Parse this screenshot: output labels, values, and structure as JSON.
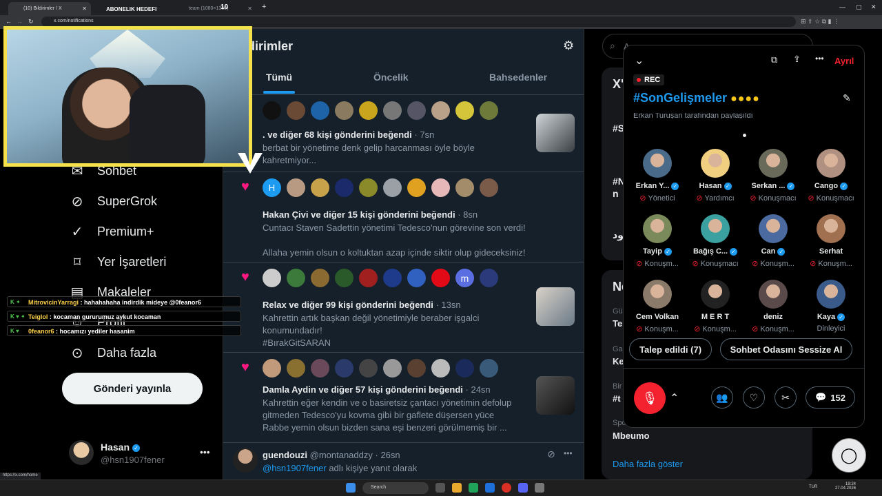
{
  "browser": {
    "tabs": [
      {
        "label": "(10) Bildirimler / X"
      },
      {
        "label": "ABONELIK HEDEFI"
      },
      {
        "label": "team (1080×1300)"
      },
      {
        "label": "10"
      }
    ],
    "url": "x.com/notifications",
    "status_url": "https://x.com/home"
  },
  "nav": {
    "items": [
      {
        "label": "Sohbet",
        "icon": "chat-icon"
      },
      {
        "label": "SuperGrok",
        "icon": "grok-icon"
      },
      {
        "label": "Premium+",
        "icon": "premium-icon"
      },
      {
        "label": "Yer İşaretleri",
        "icon": "bookmark-icon"
      },
      {
        "label": "Makaleler",
        "icon": "article-icon"
      },
      {
        "label": "Profil",
        "icon": "profile-icon"
      },
      {
        "label": "Daha fazla",
        "icon": "more-icon"
      }
    ],
    "post_button": "Gönderi yayınla",
    "account": {
      "name": "Hasan",
      "handle": "@hsn1907fener"
    }
  },
  "feed": {
    "title": "dirimler",
    "tabs": [
      "Tümü",
      "Öncelik",
      "Bahsedenler"
    ],
    "notifications": [
      {
        "actor": ".",
        "rest": " ve diğer 68 kişi gönderini beğendi",
        "time": "· 7sn",
        "lines": [
          "berbat bir yönetime denk gelip harcanması öyle böyle",
          "kahretmiyor..."
        ]
      },
      {
        "actor": "Hakan Çivi",
        "rest": " ve diğer 15 kişi gönderini beğendi",
        "time": "· 8sn",
        "lines": [
          "Cuntacı Staven Sadettin yönetimi Tedesco'nun görevine son verdi!",
          "",
          "Allaha yemin olsun o koltuktan azap içinde siktir olup gideceksiniz!"
        ]
      },
      {
        "actor": "Relax",
        "rest": " ve diğer 99 kişi gönderini beğendi",
        "time": "· 13sn",
        "lines": [
          "Kahrettin artık başkan değil yönetimiyle beraber işgalci",
          "konumundadır!",
          "#BırakGitSARAN"
        ]
      },
      {
        "actor": "Damla Aydin",
        "rest": " ve diğer 57 kişi gönderini beğendi",
        "time": "· 24sn",
        "lines": [
          "Kahrettin eğer kendin ve o basiretsiz çantacı yönetimin defolup",
          "gitmeden Tedesco'yu kovma gibi bir gaflete düşersen yüce",
          "Rabbe yemin olsun bizden sana eşi benzeri görülmemiş bir ..."
        ]
      }
    ],
    "reply": {
      "name": "guendouzi",
      "handle": "@montanaddzy",
      "time": "· 26sn",
      "mention": "@hsn1907fener",
      "mention_rest": " adlı kişiye yanıt olarak"
    },
    "avatar_letters": {
      "h": "H",
      "m": "m"
    }
  },
  "right": {
    "search_prefix": "A",
    "card1_title": "X'",
    "card1_rows": [
      "#S",
      "#N",
      "n",
      "بود"
    ],
    "card2_title": "Ne",
    "card2_rows": [
      {
        "small": "Gü",
        "big": "Te"
      },
      {
        "small": "Ga",
        "big": "Ke"
      },
      {
        "small": "Bir",
        "big": "#t"
      },
      {
        "small": "Spo",
        "big": "Mbeumo"
      }
    ],
    "show_more": "Daha fazla göster"
  },
  "space": {
    "leave_label": "Ayrıl",
    "rec_label": "REC",
    "title": "#SonGelişmeler",
    "shared_by": "Erkan Turuşan tarafından paylaşıldı",
    "participants": [
      {
        "name": "Erkan Y...",
        "role": "Yönetici",
        "verified": true
      },
      {
        "name": "Hasan",
        "role": "Yardımcı",
        "verified": true
      },
      {
        "name": "Serkan ...",
        "role": "Konuşmacı",
        "verified": true
      },
      {
        "name": "Cango",
        "role": "Konuşmacı",
        "verified": true
      },
      {
        "name": "Tayip",
        "role": "Konuşm...",
        "verified": true
      },
      {
        "name": "Bağış C...",
        "role": "Konuşmacı",
        "verified": true
      },
      {
        "name": "Can",
        "role": "Konuşm...",
        "verified": true
      },
      {
        "name": "Serhat",
        "role": "Konuşm...",
        "verified": false
      },
      {
        "name": "Cem Volkan",
        "role": "Konuşm...",
        "verified": false
      },
      {
        "name": "M E R T",
        "role": "Konuşm...",
        "verified": false
      },
      {
        "name": "deniz",
        "role": "Konuşm...",
        "verified": false
      },
      {
        "name": "Kaya",
        "role": "Dinleyici",
        "verified": true
      }
    ],
    "requests_button": "Talep edildi (7)",
    "mute_room_button": "Sohbet Odasını Sessize Al",
    "comment_count": "152"
  },
  "chat": [
    {
      "user": "MitrovicinYarragi",
      "msg": " : hahahahaha indirdik mideye @0feanor6"
    },
    {
      "user": "Teiglol",
      "msg": " : kocaman gururumuz aykut kocaman"
    },
    {
      "user": "0feanor6",
      "msg": " : hocamızı yediler hasanim"
    }
  ],
  "taskbar": {
    "search": "Search",
    "lang": "TUR",
    "time": "19:24",
    "date": "27.04.2026"
  },
  "colors": {
    "accent": "#1d9bf0",
    "like": "#f91880",
    "mute_red": "#f4212e",
    "cam_border": "#f5e14b"
  }
}
